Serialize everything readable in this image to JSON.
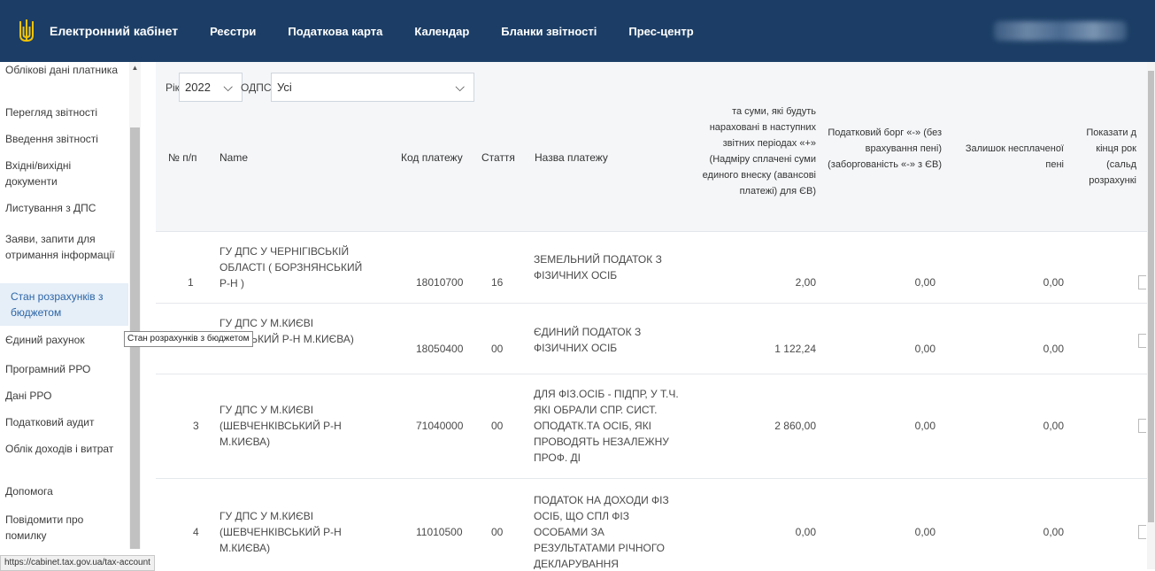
{
  "header": {
    "brand": "Електронний кабінет",
    "nav": [
      "Реєстри",
      "Податкова карта",
      "Календар",
      "Бланки звітності",
      "Прес-центр"
    ]
  },
  "sidebar": {
    "items": [
      {
        "label": "Облікові дані платника"
      },
      {
        "label": "Перегляд звітності"
      },
      {
        "label": "Введення звітності"
      },
      {
        "label": "Вхідні/вихідні документи"
      },
      {
        "label": "Листування з ДПС"
      },
      {
        "label": "Заяви, запити для отримання інформації"
      },
      {
        "label": "Стан розрахунків з бюджетом"
      },
      {
        "label": "Єдиний рахунок"
      },
      {
        "label": "Програмний РРО"
      },
      {
        "label": "Дані РРО"
      },
      {
        "label": "Податковий аудит"
      },
      {
        "label": "Облік доходів і витрат"
      },
      {
        "label": "Допомога"
      },
      {
        "label": "Повідомити про помилку"
      }
    ]
  },
  "filters": {
    "year_label": "Рік",
    "year_value": "2022",
    "odps_label": "ОДПС",
    "odps_value": "Усі"
  },
  "table": {
    "headers": {
      "num": "№ п/п",
      "name": "Name",
      "code": "Код платежу",
      "article": "Стаття",
      "payname": "Назва платежу",
      "accrued": "та суми, які будуть нараховані в наступних звітних періодах «+» (Надміру сплачені суми единого внеску (авансові платежі) для ЄВ)",
      "debt": "Податковий борг «-» (без врахування пені) (заборгованість «-» з ЄВ)",
      "penalty": "Залишок несплаченої пені",
      "show": "Показати д кінця рок (сальд розрахункі"
    },
    "rows": [
      {
        "num": "1",
        "name": "ГУ ДПС У ЧЕРНІГІВСЬКІЙ ОБЛАСТІ ( БОРЗНЯНСЬКИЙ Р-Н )",
        "code": "18010700",
        "article": "16",
        "payname": "ЗЕМЕЛЬНИЙ ПОДАТОК З ФІЗИЧНИХ ОСІБ",
        "accrued": "2,00",
        "debt": "0,00",
        "penalty": "0,00"
      },
      {
        "num": "",
        "name": "ГУ ДПС У М.КИЄВІ НКІВСЬКИЙ Р-Н М.КИЄВА)",
        "code": "18050400",
        "article": "00",
        "payname": "ЄДИНИЙ ПОДАТОК З ФІЗИЧНИХ ОСІБ",
        "accrued": "1 122,24",
        "debt": "0,00",
        "penalty": "0,00"
      },
      {
        "num": "3",
        "name": "ГУ ДПС У М.КИЄВІ (ШЕВЧЕНКІВСЬКИЙ Р-Н М.КИЄВА)",
        "code": "71040000",
        "article": "00",
        "payname": "ДЛЯ ФІЗ.ОСІБ - ПІДПР, У Т.Ч. ЯКІ ОБРАЛИ СПР. СИСТ. ОПОДАТК.ТА ОСІБ, ЯКІ ПРОВОДЯТЬ НЕЗАЛЕЖНУ ПРОФ. ДІ",
        "accrued": "2 860,00",
        "debt": "0,00",
        "penalty": "0,00"
      },
      {
        "num": "4",
        "name": "ГУ ДПС У М.КИЄВІ (ШЕВЧЕНКІВСЬКИЙ Р-Н М.КИЄВА)",
        "code": "11010500",
        "article": "00",
        "payname": "ПОДАТОК НА ДОХОДИ ФІЗ ОСІБ, ЩО СПЛ ФІЗ ОСОБАМИ ЗА РЕЗУЛЬТАТАМИ РІЧНОГО ДЕКЛАРУВАННЯ",
        "accrued": "0,00",
        "debt": "0,00",
        "penalty": "0,00"
      }
    ]
  },
  "tooltip": "Стан розрахунків з бюджетом",
  "status_url": "https://cabinet.tax.gov.ua/tax-account"
}
